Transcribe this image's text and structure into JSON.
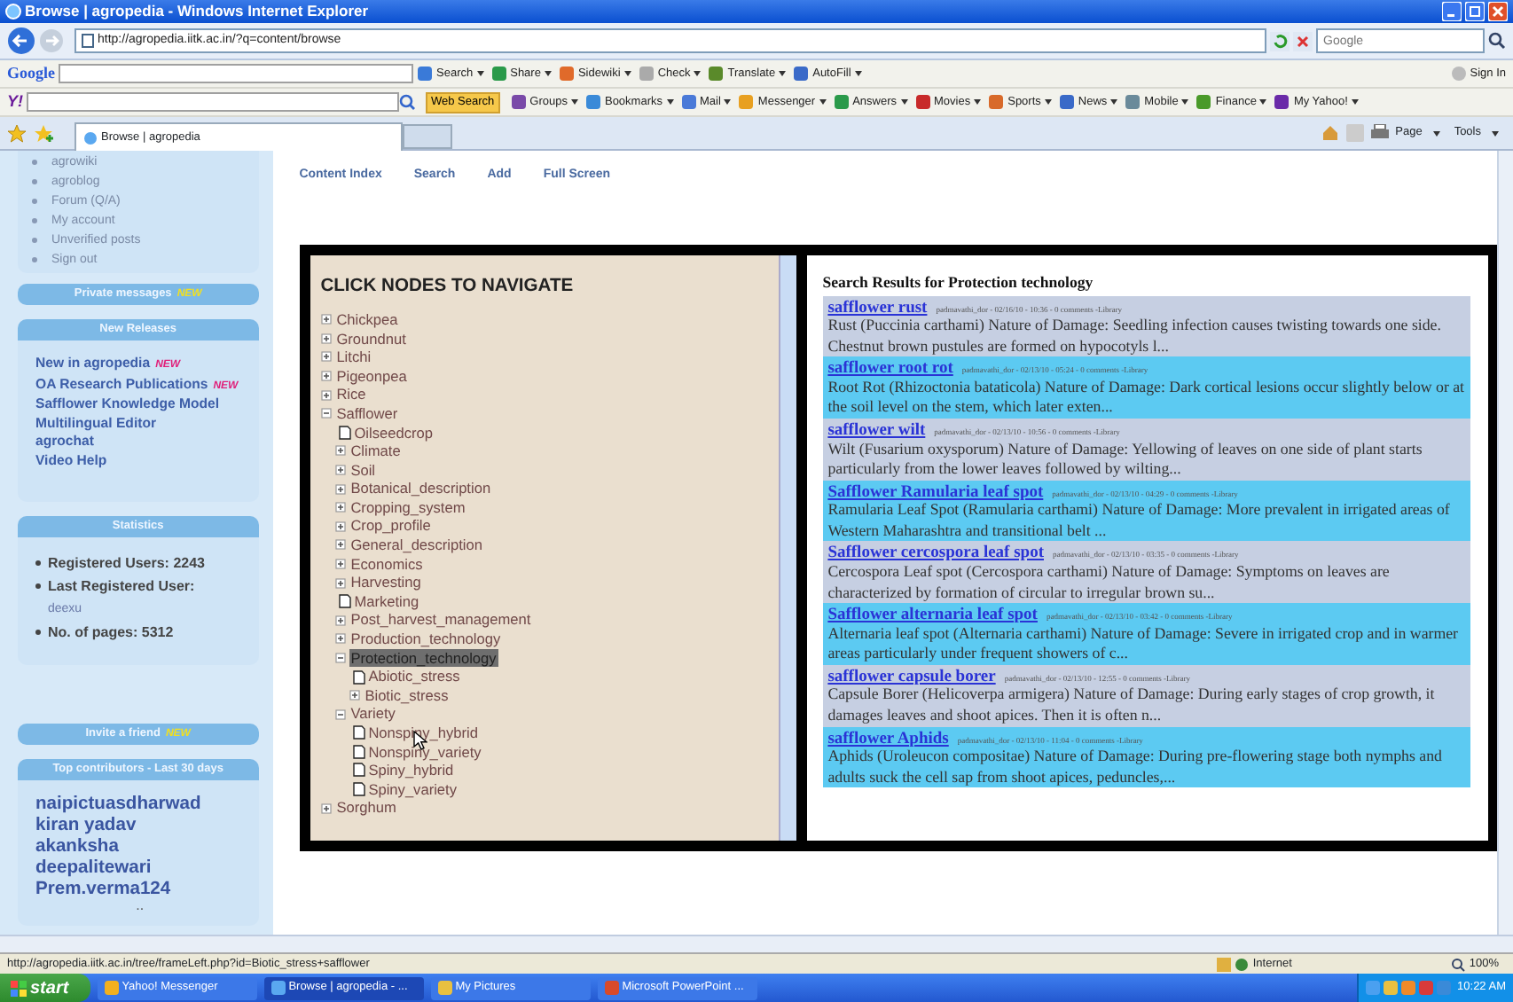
{
  "window": {
    "title": "Browse | agropedia - Windows Internet Explorer"
  },
  "address_bar": {
    "url": "http://agropedia.iitk.ac.in/?q=content/browse",
    "search_placeholder": "Google"
  },
  "google_toolbar": {
    "logo": "Google",
    "items": [
      "Search",
      "Share",
      "Sidewiki",
      "Check",
      "Translate",
      "AutoFill"
    ],
    "sign_in": "Sign In"
  },
  "yahoo_toolbar": {
    "logo": "Y!",
    "search_button": "Web Search",
    "items": [
      "Groups",
      "Bookmarks",
      "Mail",
      "Messenger",
      "Answers",
      "Movies",
      "Sports",
      "News",
      "Mobile",
      "Finance",
      "My Yahoo!"
    ]
  },
  "tabs": [
    {
      "label": "Browse | agropedia",
      "selected": true
    }
  ],
  "command_bar": [
    "Page",
    "Tools"
  ],
  "sidebar": {
    "menu": [
      "agrowiki",
      "agroblog",
      "Forum (Q/A)",
      "My account",
      "Unverified posts",
      "Sign out"
    ],
    "blocks": [
      {
        "kind": "collapsed",
        "title": "Private messages",
        "badge": "NEW"
      },
      {
        "kind": "links",
        "title": "New Releases",
        "links": [
          {
            "text": "New in agropedia",
            "badge": "NEW"
          },
          {
            "text": "OA Research Publications",
            "badge": "NEW"
          },
          {
            "text": "Safflower Knowledge Model"
          },
          {
            "text": "Multilingual Editor"
          },
          {
            "text": "agrochat"
          },
          {
            "text": "Video Help"
          }
        ]
      },
      {
        "kind": "stats",
        "title": "Statistics",
        "items": [
          {
            "label": "Registered Users: 2243"
          },
          {
            "label": "Last Registered User:",
            "value": "deexu"
          },
          {
            "label": "No. of pages: 5312"
          }
        ]
      },
      {
        "kind": "collapsed",
        "title": "Invite a friend",
        "badge": "NEW"
      },
      {
        "kind": "contributors",
        "title": "Top contributors - Last 30 days",
        "links": [
          {
            "text": "naipictuasdharwad"
          },
          {
            "text": "kiran yadav"
          },
          {
            "text": "akanksha"
          },
          {
            "text": "deepalitewari"
          },
          {
            "text": "Prem.verma124"
          }
        ],
        "more": ".."
      }
    ]
  },
  "content_links": [
    "Content Index",
    "Search",
    "Add",
    "Full Screen"
  ],
  "tree": {
    "heading": "CLICK NODES TO NAVIGATE",
    "nodes": [
      {
        "label": "Chickpea",
        "kind": "folder",
        "expanded": false,
        "selected": false
      },
      {
        "label": "Groundnut",
        "kind": "folder",
        "expanded": false,
        "selected": false
      },
      {
        "label": "Litchi",
        "kind": "folder",
        "expanded": false,
        "selected": false
      },
      {
        "label": "Pigeonpea",
        "kind": "folder",
        "expanded": false,
        "selected": false
      },
      {
        "label": "Rice",
        "kind": "folder",
        "expanded": false,
        "selected": false
      },
      {
        "label": "Safflower",
        "kind": "folder",
        "expanded": true,
        "selected": false,
        "children": [
          {
            "label": "Oilseedcrop",
            "kind": "leaf",
            "selected": false
          },
          {
            "label": "Climate",
            "kind": "folder",
            "expanded": false,
            "selected": false
          },
          {
            "label": "Soil",
            "kind": "folder",
            "expanded": false,
            "selected": false
          },
          {
            "label": "Botanical_description",
            "kind": "folder",
            "expanded": false,
            "selected": false
          },
          {
            "label": "Cropping_system",
            "kind": "folder",
            "expanded": false,
            "selected": false
          },
          {
            "label": "Crop_profile",
            "kind": "folder",
            "expanded": false,
            "selected": false
          },
          {
            "label": "General_description",
            "kind": "folder",
            "expanded": false,
            "selected": false
          },
          {
            "label": "Economics",
            "kind": "folder",
            "expanded": false,
            "selected": false
          },
          {
            "label": "Harvesting",
            "kind": "folder",
            "expanded": false,
            "selected": false
          },
          {
            "label": "Marketing",
            "kind": "leaf",
            "selected": false
          },
          {
            "label": "Post_harvest_management",
            "kind": "folder",
            "expanded": false,
            "selected": false
          },
          {
            "label": "Production_technology",
            "kind": "folder",
            "expanded": false,
            "selected": false
          },
          {
            "label": "Protection_technology",
            "kind": "folder",
            "expanded": true,
            "selected": true,
            "children": [
              {
                "label": "Abiotic_stress",
                "kind": "leaf",
                "selected": false
              },
              {
                "label": "Biotic_stress",
                "kind": "folder",
                "expanded": false,
                "selected": false
              }
            ]
          },
          {
            "label": "Variety",
            "kind": "folder",
            "expanded": true,
            "selected": false,
            "children": [
              {
                "label": "Nonspiny_hybrid",
                "kind": "leaf",
                "selected": false
              },
              {
                "label": "Nonspiny_variety",
                "kind": "leaf",
                "selected": false
              },
              {
                "label": "Spiny_hybrid",
                "kind": "leaf",
                "selected": false
              },
              {
                "label": "Spiny_variety",
                "kind": "leaf",
                "selected": false
              }
            ]
          }
        ]
      },
      {
        "label": "Sorghum",
        "kind": "folder",
        "expanded": false,
        "selected": false
      }
    ]
  },
  "results": {
    "heading": "Search Results for Protection technology",
    "items": [
      {
        "title": "safflower rust",
        "meta": "padmavathi_dor - 02/16/10 - 10:36 - 0 comments -Library",
        "snippet": "Rust (Puccinia carthami) Nature of Damage: Seedling infection causes twisting towards one side. Chestnut brown pustules are formed on hypocotyls l..."
      },
      {
        "title": "safflower root rot",
        "meta": "padmavathi_dor - 02/13/10 - 05:24 - 0 comments -Library",
        "snippet": "Root Rot (Rhizoctonia bataticola) Nature of Damage: Dark cortical lesions occur slightly below or at the soil level on the stem, which later exten..."
      },
      {
        "title": "safflower wilt",
        "meta": "padmavathi_dor - 02/13/10 - 10:56 - 0 comments -Library",
        "snippet": "Wilt (Fusarium oxysporum) Nature of Damage: Yellowing of leaves on one side of plant starts particularly from the lower leaves followed by wilting..."
      },
      {
        "title": "Safflower Ramularia leaf spot",
        "meta": "padmavathi_dor - 02/13/10 - 04:29 - 0 comments -Library",
        "snippet": "Ramularia Leaf Spot (Ramularia carthami) Nature of Damage: More prevalent in irrigated areas of Western Maharashtra and transitional belt ..."
      },
      {
        "title": "Safflower cercospora leaf spot",
        "meta": "padmavathi_dor - 02/13/10 - 03:35 - 0 comments -Library",
        "snippet": "Cercospora Leaf spot (Cercospora carthami) Nature of Damage: Symptoms on leaves are characterized by formation of circular to irregular brown su..."
      },
      {
        "title": "Safflower alternaria leaf spot",
        "meta": "padmavathi_dor - 02/13/10 - 03:42 - 0 comments -Library",
        "snippet": "Alternaria leaf spot (Alternaria carthami) Nature of Damage: Severe in irrigated crop and in warmer areas particularly under frequent showers of c..."
      },
      {
        "title": "safflower capsule borer",
        "meta": "padmavathi_dor - 02/13/10 - 12:55 - 0 comments -Library",
        "snippet": "Capsule Borer (Helicoverpa armigera) Nature of Damage: During early stages of crop growth, it damages leaves and shoot apices. Then it is often n..."
      },
      {
        "title": "safflower Aphids",
        "meta": "padmavathi_dor - 02/13/10 - 11:04 - 0 comments -Library",
        "snippet": "Aphids (Uroleucon compositae) Nature of Damage: During pre-flowering stage both nymphs and adults suck the cell sap from shoot apices, peduncles,..."
      }
    ]
  },
  "status_bar": {
    "url": "http://agropedia.iitk.ac.in/tree/frameLeft.php?id=Biotic_stress+safflower",
    "zone": "Internet",
    "zoom": "100%"
  },
  "taskbar": {
    "start": "start",
    "windows": [
      {
        "label": "Yahoo! Messenger",
        "selected": false
      },
      {
        "label": "Browse | agropedia - ...",
        "selected": true
      },
      {
        "label": "My Pictures",
        "selected": false
      },
      {
        "label": "Microsoft PowerPoint ...",
        "selected": false
      }
    ],
    "clock": "10:22 AM"
  }
}
